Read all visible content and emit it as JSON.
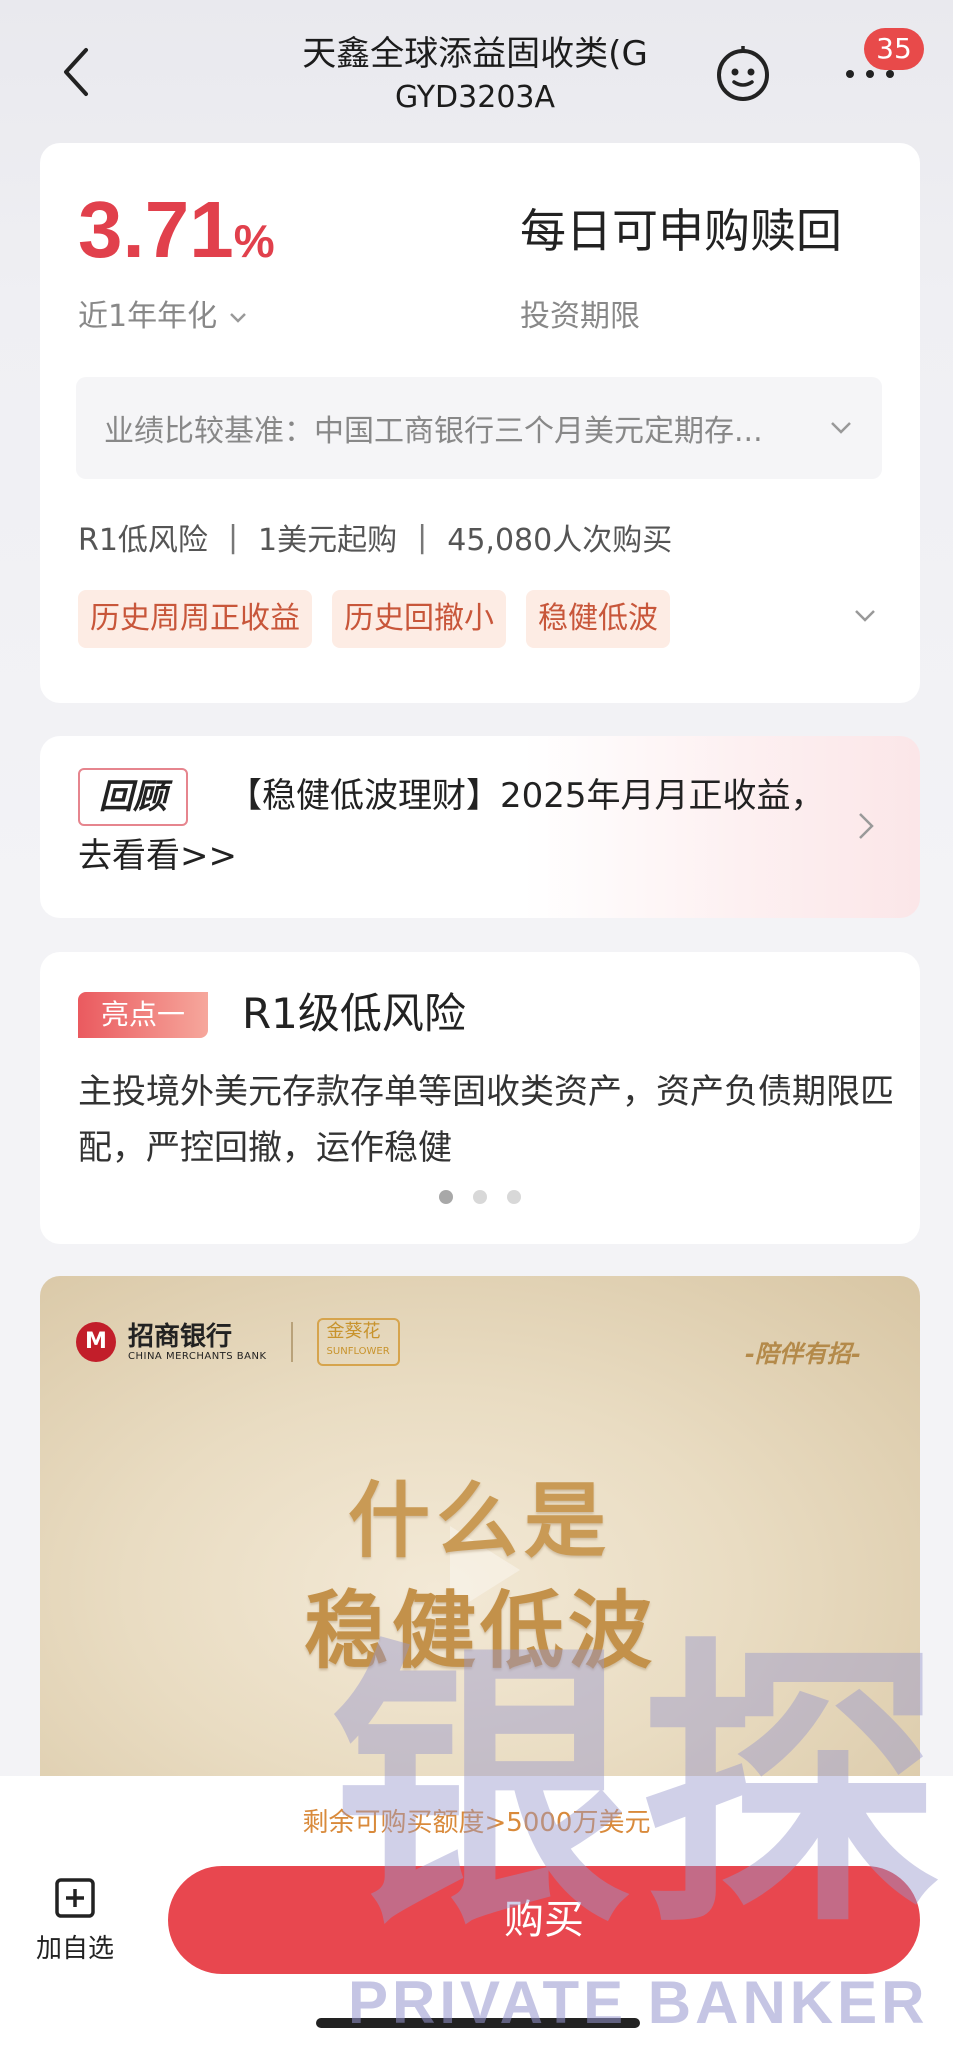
{
  "header": {
    "title": "天鑫全球添益固收类(G",
    "code": "GYD3203A",
    "badge_count": "35",
    "icons": [
      "back-chevron-icon",
      "robot-face-icon",
      "more-dots-icon"
    ]
  },
  "summary": {
    "rate_value": "3.71",
    "rate_unit": "%",
    "rate_label": "近1年年化",
    "period_value": "每日可申购赎回",
    "period_label": "投资期限",
    "benchmark": "业绩比较基准：中国工商银行三个月美元定期存...",
    "risk": "R1低风险",
    "min_purchase": "1美元起购",
    "buyers": "45,080人次购买",
    "tags": [
      "历史周周正收益",
      "历史回撤小",
      "稳健低波"
    ],
    "accent_color": "#e1404c"
  },
  "review": {
    "badge": "回顾",
    "text": "【稳健低波理财】2025年月月正收益，去看看>>"
  },
  "highlight": {
    "badge": "亮点一",
    "title": "R1级低风险",
    "description": "主投境外美元存款存单等固收类资产，资产负债期限匹配，严控回撤，运作稳健",
    "active_slide": 1,
    "total_slides": 3
  },
  "banner": {
    "bank_name": "招商银行",
    "bank_name_en": "CHINA MERCHANTS BANK",
    "sub_brand": "金葵花",
    "sub_brand_en": "SUNFLOWER",
    "slogan": "-陪伴有招-",
    "title_line1": "什么是",
    "title_line2": "稳健低波"
  },
  "watermark": {
    "cn": "银探",
    "en": "PRIVATE BANKER"
  },
  "bottom": {
    "quota": "剩余可购买额度>5000万美元",
    "watchlist_label": "加自选",
    "buy_label": "购买",
    "buy_color": "#e8474f"
  }
}
